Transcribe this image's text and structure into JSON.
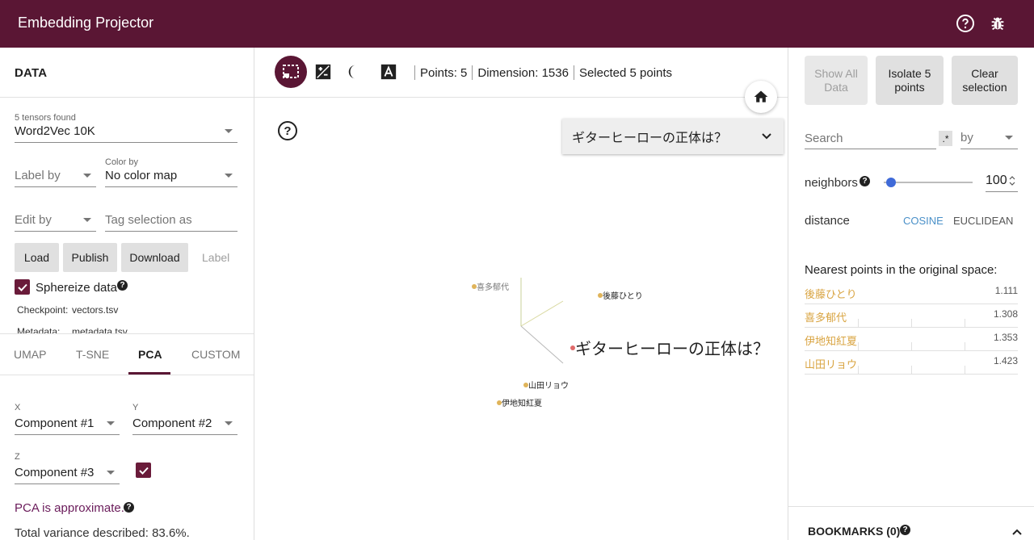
{
  "header": {
    "title": "Embedding Projector"
  },
  "data_panel": {
    "title": "DATA",
    "tensors_found": "5 tensors found",
    "tensor_selected": "Word2Vec 10K",
    "label_by": "Label by",
    "color_by_label": "Color by",
    "color_by_value": "No color map",
    "edit_by": "Edit by",
    "tag_placeholder": "Tag selection as",
    "buttons": {
      "load": "Load",
      "publish": "Publish",
      "download": "Download",
      "label": "Label"
    },
    "sphereize": "Sphereize data",
    "checkpoint_key": "Checkpoint:",
    "checkpoint_val": "vectors.tsv",
    "metadata_key": "Metadata:",
    "metadata_val": "metadata.tsv"
  },
  "projection_tabs": [
    "UMAP",
    "T-SNE",
    "PCA",
    "CUSTOM"
  ],
  "pca": {
    "x_label": "X",
    "x_value": "Component #1",
    "y_label": "Y",
    "y_value": "Component #2",
    "z_label": "Z",
    "z_value": "Component #3",
    "note": "PCA is approximate.",
    "variance": "Total variance described: 83.6%."
  },
  "center": {
    "points": "Points: 5",
    "dimension": "Dimension: 1536",
    "selected": "Selected 5 points",
    "selected_label": "ギターヒーローの正体は？",
    "point_labels": {
      "kita": "喜多郁代",
      "goto": "後藤ひとり",
      "guitar": "ギターヒーローの正体は？",
      "yamada": "山田リョウ",
      "ijichi": "伊地知紅夏"
    }
  },
  "inspector": {
    "show_all": "Show All Data",
    "isolate": "Isolate 5 points",
    "clear": "Clear selection",
    "search_placeholder": "Search",
    "regex": ".*",
    "by": "by",
    "neighbors_label": "neighbors",
    "neighbors_value": "100",
    "neighbors_fraction": 0.03,
    "distance_label": "distance",
    "cosine": "COSINE",
    "euclidean": "EUCLIDEAN",
    "nearest_title": "Nearest points in the original space:",
    "nearest": [
      {
        "name": "後藤ひとり",
        "value": "1.111"
      },
      {
        "name": "喜多郁代",
        "value": "1.308"
      },
      {
        "name": "伊地知紅夏",
        "value": "1.353"
      },
      {
        "name": "山田リョウ",
        "value": "1.423"
      }
    ],
    "bookmarks": "BOOKMARKS (0)"
  },
  "colors": {
    "header": "#5a1634",
    "accent": "#6a1b3a",
    "point": "#e0b45a",
    "selected_point": "#e06b6b",
    "cosine": "#4a90c8"
  }
}
